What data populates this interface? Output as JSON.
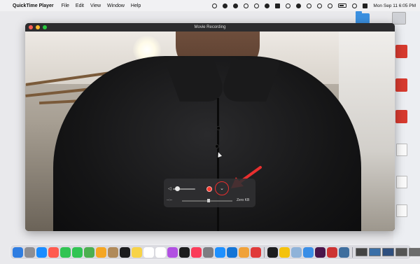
{
  "menubar": {
    "apple": "",
    "menus": [
      "QuickTime Player",
      "File",
      "Edit",
      "View",
      "Window",
      "Help"
    ],
    "clock": "Mon Sep 11  6:05 PM"
  },
  "window": {
    "title": "Movie Recording"
  },
  "controls": {
    "volume_icon": "speaker-icon",
    "chevron": "⌄",
    "time": "--:--",
    "file_size": "Zero KB",
    "volume_level": 0.05,
    "record_color": "#ff3b30",
    "highlight_color": "#e82f2f"
  },
  "dock": {
    "icons": [
      {
        "name": "finder-icon",
        "color": "#2f7de1"
      },
      {
        "name": "launchpad-icon",
        "color": "#8e8e93"
      },
      {
        "name": "safari-icon",
        "color": "#1a8cff"
      },
      {
        "name": "calendar-small-icon",
        "color": "#ff5a4f"
      },
      {
        "name": "facetime-icon",
        "color": "#31c453"
      },
      {
        "name": "messages-icon",
        "color": "#31c453"
      },
      {
        "name": "maps-icon",
        "color": "#4caf50"
      },
      {
        "name": "photos-icon",
        "color": "#f5a623"
      },
      {
        "name": "contacts-icon",
        "color": "#b08a5a"
      },
      {
        "name": "stocks-icon",
        "color": "#1c1c1e"
      },
      {
        "name": "notes-icon",
        "color": "#f7d348"
      },
      {
        "name": "reminders-icon",
        "color": "#ffffff"
      },
      {
        "name": "calendar-icon",
        "color": "#ffffff"
      },
      {
        "name": "podcasts-icon",
        "color": "#b150e2"
      },
      {
        "name": "tv-icon",
        "color": "#1c1c1e"
      },
      {
        "name": "music-icon",
        "color": "#fa3c5a"
      },
      {
        "name": "settings-icon",
        "color": "#7d7d82"
      },
      {
        "name": "appstore-icon",
        "color": "#1e90ff"
      },
      {
        "name": "xcode-icon",
        "color": "#1575d6"
      },
      {
        "name": "pencil-icon",
        "color": "#f0a23a"
      },
      {
        "name": "vivaldi-icon",
        "color": "#e03a3a"
      }
    ],
    "icons2": [
      {
        "name": "terminal-icon",
        "color": "#1c1c1e"
      },
      {
        "name": "chrome-icon",
        "color": "#f4c20d"
      },
      {
        "name": "preview-icon",
        "color": "#8fb3d9"
      },
      {
        "name": "quicktime-icon",
        "color": "#3a8ee6"
      },
      {
        "name": "slack-icon",
        "color": "#4a154b"
      },
      {
        "name": "photo-booth-icon",
        "color": "#cc3333"
      },
      {
        "name": "clock-icon",
        "color": "#3f6e9e"
      }
    ],
    "thumbs": [
      {
        "name": "minimized-window-1",
        "color": "#444"
      },
      {
        "name": "minimized-window-2",
        "color": "#3a6fa8"
      },
      {
        "name": "minimized-window-3",
        "color": "#2f4f7f"
      },
      {
        "name": "minimized-window-4",
        "color": "#555"
      },
      {
        "name": "minimized-window-5",
        "color": "#6c6c6c"
      }
    ],
    "trash": {
      "name": "trash-icon",
      "color": "#c9ccd1"
    }
  }
}
